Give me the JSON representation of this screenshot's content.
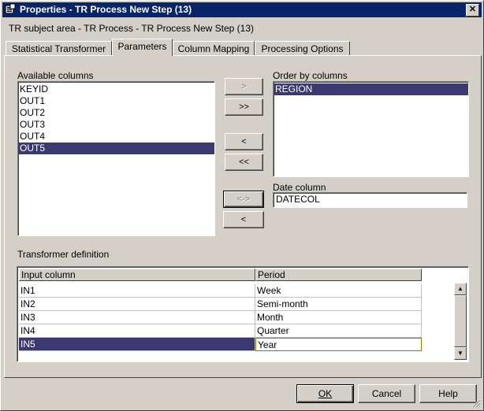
{
  "window": {
    "title": "Properties - TR Process New Step (13)",
    "close_label": "✕"
  },
  "subtitle": "TR subject area - TR Process - TR Process New Step (13)",
  "tabs": [
    {
      "label": "Statistical Transformer",
      "active": false
    },
    {
      "label": "Parameters",
      "active": true
    },
    {
      "label": "Column Mapping",
      "active": false
    },
    {
      "label": "Processing Options",
      "active": false
    }
  ],
  "available_columns": {
    "label": "Available columns",
    "items": [
      "KEYID",
      "OUT1",
      "OUT2",
      "OUT3",
      "OUT4",
      "OUT5"
    ],
    "selected": "OUT5"
  },
  "move_buttons": {
    "add_one": ">",
    "add_all": ">>",
    "remove_one": "<",
    "remove_all": "<<",
    "swap_date": "<->",
    "remove_date": "<"
  },
  "order_by": {
    "label": "Order by columns",
    "items": [
      "REGION"
    ],
    "selected": "REGION"
  },
  "date_column": {
    "label": "Date column",
    "value": "DATECOL"
  },
  "transformer": {
    "label": "Transformer definition",
    "headers": [
      "Input column",
      "Period"
    ],
    "rows": [
      {
        "input": "IN1",
        "period": "Week"
      },
      {
        "input": "IN2",
        "period": "Semi-month"
      },
      {
        "input": "IN3",
        "period": "Month"
      },
      {
        "input": "IN4",
        "period": "Quarter"
      },
      {
        "input": "IN5",
        "period": "Year"
      }
    ],
    "selected_row": 4
  },
  "footer": {
    "ok": "OK",
    "cancel": "Cancel",
    "help": "Help"
  },
  "colors": {
    "title_bar": "#0a246a",
    "selection": "#3a3a70",
    "face": "#d4d0c8"
  }
}
